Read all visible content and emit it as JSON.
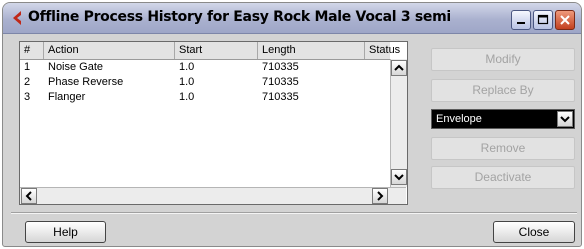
{
  "window": {
    "title": "Offline Process History for Easy Rock Male Vocal 3 semi",
    "controls": [
      "minimize",
      "maximize",
      "close"
    ]
  },
  "table": {
    "columns": [
      "#",
      "Action",
      "Start",
      "Length",
      "Status"
    ],
    "rows": [
      {
        "num": "1",
        "action": "Noise Gate",
        "start": "1.0",
        "length": "710335",
        "status": ""
      },
      {
        "num": "2",
        "action": "Phase Reverse",
        "start": "1.0",
        "length": "710335",
        "status": ""
      },
      {
        "num": "3",
        "action": "Flanger",
        "start": "1.0",
        "length": "710335",
        "status": ""
      }
    ]
  },
  "side_panel": {
    "modify_label": "Modify",
    "replace_by_label": "Replace By",
    "replace_select_value": "Envelope",
    "remove_label": "Remove",
    "deactivate_label": "Deactivate"
  },
  "footer": {
    "help_label": "Help",
    "close_label": "Close"
  },
  "colors": {
    "titlebar": "#aab1cf",
    "close_button": "#c24020",
    "dropdown_bg": "#000000",
    "disabled_text": "#a3a3a3"
  }
}
